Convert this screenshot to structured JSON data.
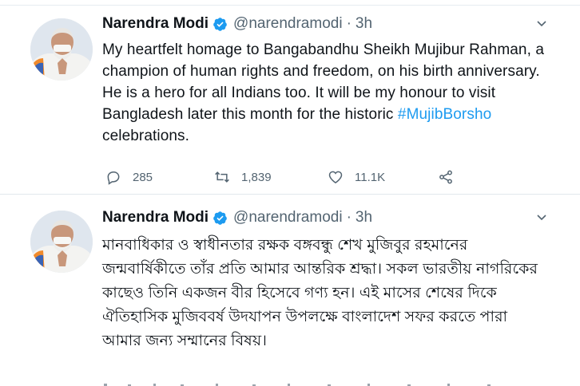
{
  "tweets": [
    {
      "author_name": "Narendra Modi",
      "handle": "@narendramodi",
      "separator": "·",
      "time": "3h",
      "text_before": "My heartfelt homage to Bangabandhu Sheikh Mujibur Rahman, a champion of human rights and freedom, on his birth anniversary. He is a hero for all Indians too. It will be my honour to visit Bangladesh later this month for the historic ",
      "hashtag": "#MujibBorsho",
      "text_after": " celebrations.",
      "replies": "285",
      "retweets": "1,839",
      "likes": "11.1K"
    },
    {
      "author_name": "Narendra Modi",
      "handle": "@narendramodi",
      "separator": "·",
      "time": "3h",
      "text": "মানবাধিকার ও স্বাধীনতার রক্ষক বঙ্গবন্ধু শেখ মুজিবুর রহমানের জন্মবার্ষিকীতে তাঁর প্রতি আমার আন্তরিক শ্রদ্ধা। সকল ভারতীয় নাগরিকের কাছেও তিনি একজন বীর হিসেবে গণ্য হন। এই মাসের শেষের দিকে ঐতিহাসিক মুজিববর্ষ উদযাপন উপলক্ষে বাংলাদেশ সফর করতে পারা আমার জন্য সম্মানের বিষয়।"
    }
  ],
  "colors": {
    "accent": "#1d9bf0",
    "secondary_text": "#536471",
    "primary_text": "#0f1419"
  },
  "icons": {
    "verified": "verified-badge-icon",
    "more": "chevron-down-icon",
    "reply": "reply-icon",
    "retweet": "retweet-icon",
    "like": "heart-icon",
    "share": "share-icon"
  }
}
